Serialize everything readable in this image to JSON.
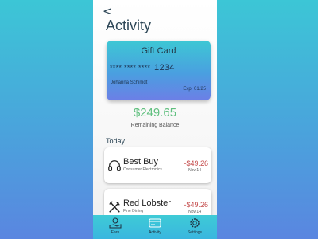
{
  "header": {
    "back_glyph": "<",
    "title": "Activity"
  },
  "card": {
    "name": "Gift Card",
    "masked": "**** **** ****",
    "last4": "1234",
    "holder": "Johanna Schimdt",
    "expiry": "Exp. 01/25"
  },
  "balance": {
    "amount": "$249.65",
    "label": "Remaining Balance"
  },
  "section_label": "Today",
  "transactions": [
    {
      "merchant": "Best Buy",
      "category": "Consumer Electronics",
      "amount": "-$49.26",
      "date": "Nov 14",
      "icon": "headphones-icon"
    },
    {
      "merchant": "Red Lobster",
      "category": "Fine Dining",
      "amount": "-$49.26",
      "date": "Nov 14",
      "icon": "utensils-icon"
    }
  ],
  "nav": [
    {
      "label": "Earn",
      "icon": "earn-icon"
    },
    {
      "label": "Activity",
      "icon": "card-icon"
    },
    {
      "label": "Settings",
      "icon": "gear-icon"
    }
  ],
  "colors": {
    "accent": "#3ecbd6",
    "positive": "#5fbf7e",
    "negative": "#c44a4a",
    "text": "#2f4858"
  }
}
